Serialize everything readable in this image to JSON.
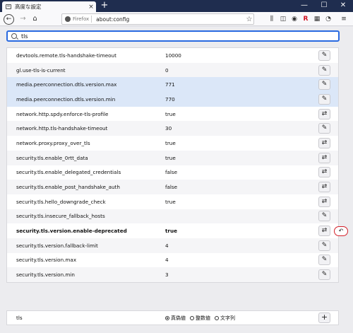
{
  "window": {
    "tab_title": "高度な設定",
    "tab_close": "×",
    "newtab": "+",
    "minimize": "—",
    "maximize": "☐",
    "close": "✕"
  },
  "toolbar": {
    "back": "←",
    "forward": "→",
    "home": "⌂",
    "url_label": "Firefox",
    "url": "about:config",
    "bookmark_star": "☆",
    "library": "⫼",
    "sidebar": "◫",
    "account": "◉",
    "ext_r": "R",
    "ext_grid": "▦",
    "ext_gauge": "◔",
    "menu": "≡"
  },
  "search": {
    "value": "tls"
  },
  "prefs": [
    {
      "name": "devtools.remote.tls-handshake-timeout",
      "value": "10000",
      "action": "edit"
    },
    {
      "name": "gl.use-tls-is-current",
      "value": "0",
      "action": "edit"
    },
    {
      "name": "media.peerconnection.dtls.version.max",
      "value": "771",
      "action": "edit"
    },
    {
      "name": "media.peerconnection.dtls.version.min",
      "value": "770",
      "action": "edit"
    },
    {
      "name": "network.http.spdy.enforce-tls-profile",
      "value": "true",
      "action": "toggle"
    },
    {
      "name": "network.http.tls-handshake-timeout",
      "value": "30",
      "action": "edit"
    },
    {
      "name": "network.proxy.proxy_over_tls",
      "value": "true",
      "action": "toggle"
    },
    {
      "name": "security.tls.enable_0rtt_data",
      "value": "true",
      "action": "toggle"
    },
    {
      "name": "security.tls.enable_delegated_credentials",
      "value": "false",
      "action": "toggle"
    },
    {
      "name": "security.tls.enable_post_handshake_auth",
      "value": "false",
      "action": "toggle"
    },
    {
      "name": "security.tls.hello_downgrade_check",
      "value": "true",
      "action": "toggle"
    },
    {
      "name": "security.tls.insecure_fallback_hosts",
      "value": "",
      "action": "edit"
    },
    {
      "name": "security.tls.version.enable-deprecated",
      "value": "true",
      "action": "toggle",
      "modified": true
    },
    {
      "name": "security.tls.version.fallback-limit",
      "value": "4",
      "action": "edit"
    },
    {
      "name": "security.tls.version.max",
      "value": "4",
      "action": "edit"
    },
    {
      "name": "security.tls.version.min",
      "value": "3",
      "action": "edit"
    }
  ],
  "icons": {
    "edit": "✎",
    "toggle": "⇄",
    "reset": "↶",
    "add": "+"
  },
  "new_pref": {
    "name": "tls",
    "types": [
      "真偽値",
      "整数値",
      "文字列"
    ],
    "selected": "真偽値"
  },
  "colors": {
    "titlebar": "#1f2d4f",
    "focus": "#2a6ae0",
    "selected_row": "#dbe7f8",
    "reset_ring": "#d4202a"
  }
}
